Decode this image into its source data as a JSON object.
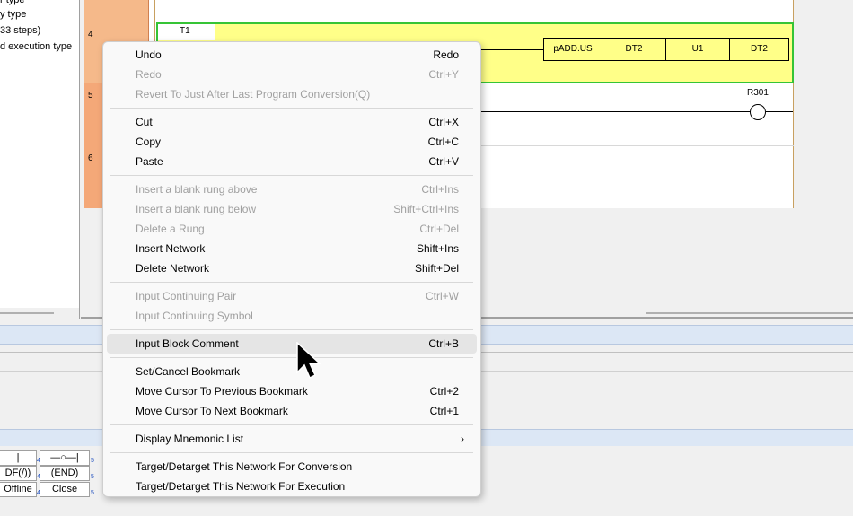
{
  "tree": {
    "lines": [
      "r type",
      "y type",
      "33 steps)",
      "d execution type"
    ]
  },
  "ladder": {
    "rungs": [
      {
        "num": "4"
      },
      {
        "num": "5"
      },
      {
        "num": "6"
      }
    ],
    "contact_label": "T1",
    "coil_label": "R301",
    "instruction": [
      "pADD.US",
      "DT2",
      "U1",
      "DT2"
    ]
  },
  "function_keys": {
    "row1": [
      "|",
      "—○—|",
      ""
    ],
    "row2": [
      "DF(/))",
      "(END)"
    ],
    "row3": [
      "Offline",
      "Close"
    ],
    "nums": [
      "4",
      "5",
      "4",
      "5",
      "4",
      "5"
    ]
  },
  "menu": {
    "items": [
      {
        "label": "Undo",
        "shortcut": "Redo",
        "disabled": false
      },
      {
        "label": "Redo",
        "shortcut": "Ctrl+Y",
        "disabled": true
      },
      {
        "label": "Revert To Just After Last Program Conversion(Q)",
        "shortcut": "",
        "disabled": true
      },
      {
        "label": "Cut",
        "shortcut": "Ctrl+X",
        "disabled": false
      },
      {
        "label": "Copy",
        "shortcut": "Ctrl+C",
        "disabled": false
      },
      {
        "label": "Paste",
        "shortcut": "Ctrl+V",
        "disabled": false
      },
      {
        "label": "Insert a blank rung above",
        "shortcut": "Ctrl+Ins",
        "disabled": true
      },
      {
        "label": "Insert a blank rung below",
        "shortcut": "Shift+Ctrl+Ins",
        "disabled": true
      },
      {
        "label": "Delete a Rung",
        "shortcut": "Ctrl+Del",
        "disabled": true
      },
      {
        "label": "Insert Network",
        "shortcut": "Shift+Ins",
        "disabled": false
      },
      {
        "label": "Delete Network",
        "shortcut": "Shift+Del",
        "disabled": false
      },
      {
        "label": "Input Continuing Pair",
        "shortcut": "Ctrl+W",
        "disabled": true
      },
      {
        "label": "Input Continuing Symbol",
        "shortcut": "",
        "disabled": true
      },
      {
        "label": "Input Block Comment",
        "shortcut": "Ctrl+B",
        "disabled": false,
        "highlighted": true
      },
      {
        "label": "Set/Cancel Bookmark",
        "shortcut": "",
        "disabled": false
      },
      {
        "label": "Move Cursor To Previous Bookmark",
        "shortcut": "Ctrl+2",
        "disabled": false
      },
      {
        "label": "Move Cursor To Next Bookmark",
        "shortcut": "Ctrl+1",
        "disabled": false
      },
      {
        "label": "Display Mnemonic List",
        "shortcut": "",
        "disabled": false,
        "submenu": true
      },
      {
        "label": "Target/Detarget This Network For Conversion",
        "shortcut": "",
        "disabled": false
      },
      {
        "label": "Target/Detarget This Network For Execution",
        "shortcut": "",
        "disabled": false
      }
    ]
  },
  "colors": {
    "rung_num_bg": "#f5b98a",
    "selected_rung_bg": "#ffff88",
    "selected_rung_border": "#36c436",
    "menu_bg": "#f9f9f9",
    "menu_highlight": "#e5e5e5"
  }
}
